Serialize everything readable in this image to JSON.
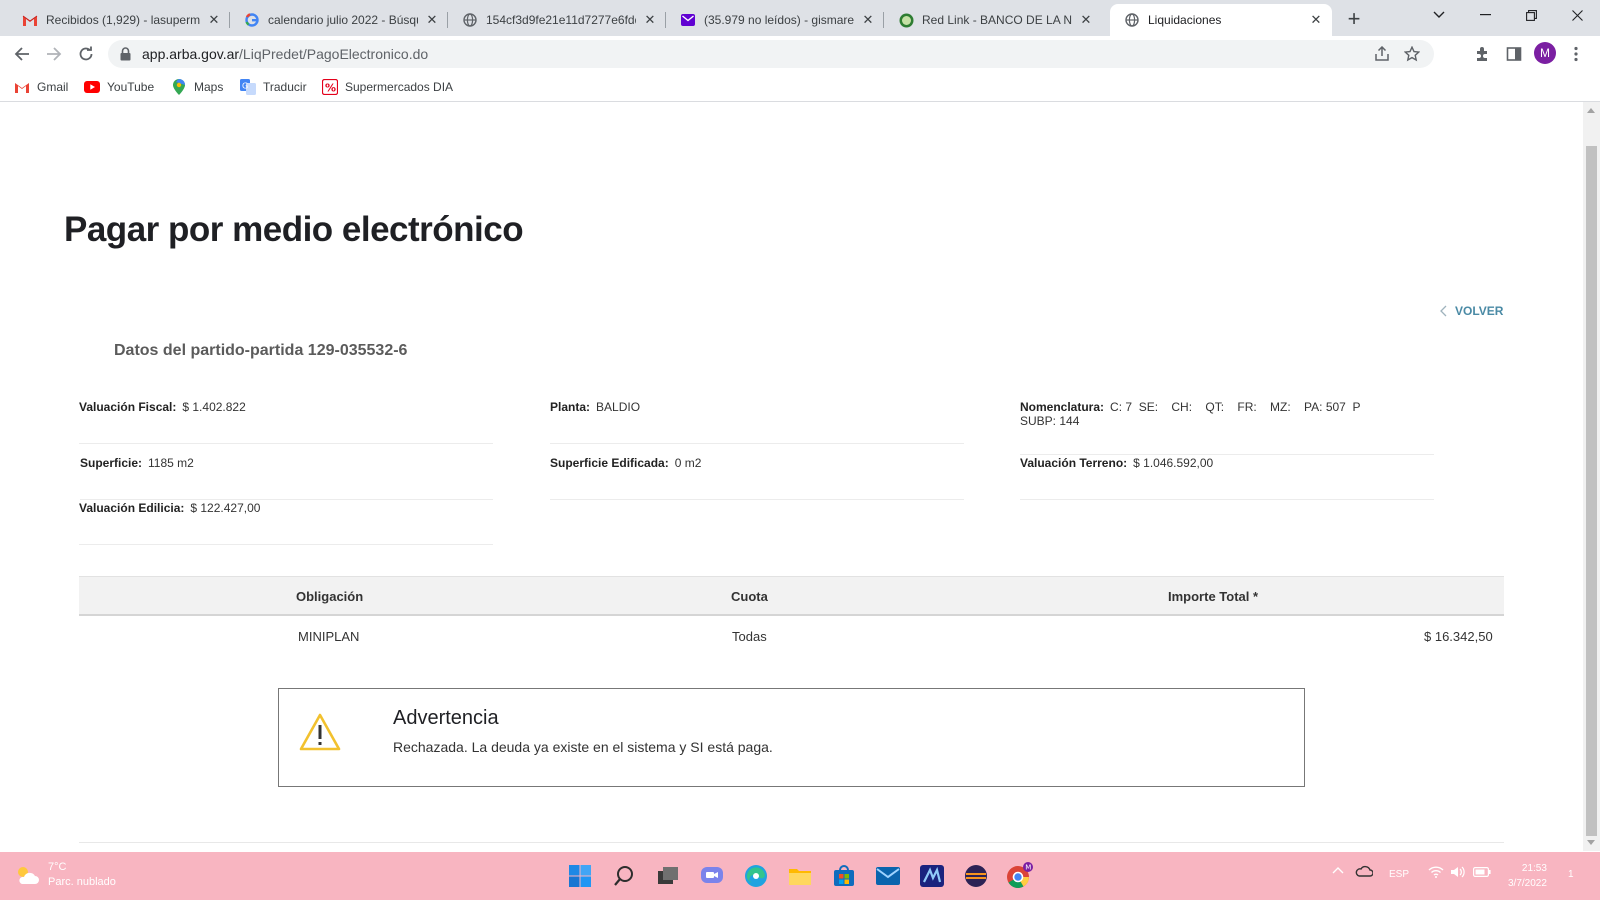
{
  "browser": {
    "tabs": [
      {
        "title": "Recibidos (1,929) - lasuperma",
        "icon": "gmail-icon"
      },
      {
        "title": "calendario julio 2022 - Búsque",
        "icon": "google-icon"
      },
      {
        "title": "154cf3d9fe21e11d7277e6fdd",
        "icon": "globe-icon"
      },
      {
        "title": "(35.979 no leídos) - gismares",
        "icon": "yahoo-mail-icon"
      },
      {
        "title": "Red Link - BANCO DE LA NAC",
        "icon": "red-link-icon"
      },
      {
        "title": "Liquidaciones",
        "icon": "globe-icon"
      }
    ],
    "active_tab": 5,
    "url_host": "app.arba.gov.ar",
    "url_path": "/LiqPredet/PagoElectronico.do",
    "profile_initial": "M",
    "bookmarks": [
      {
        "label": "Gmail",
        "icon": "gmail-icon"
      },
      {
        "label": "YouTube",
        "icon": "youtube-icon"
      },
      {
        "label": "Maps",
        "icon": "maps-icon"
      },
      {
        "label": "Traducir",
        "icon": "translate-icon"
      },
      {
        "label": "Supermercados DIA",
        "icon": "dia-icon"
      }
    ]
  },
  "page": {
    "title": "Pagar por medio electrónico",
    "back_label": "VOLVER",
    "section_title": "Datos del partido-partida 129-035532-6",
    "fields": {
      "valuacion_fiscal": {
        "label": "Valuación Fiscal:",
        "value": "$ 1.402.822"
      },
      "planta": {
        "label": "Planta:",
        "value": "BALDIO"
      },
      "nomenclatura": {
        "label": "Nomenclatura:",
        "value": "C: 7  SE:    CH:    QT:    FR:    MZ:    PA: 507  P",
        "value2": "SUBP: 144"
      },
      "superficie": {
        "label": "Superficie:",
        "value": "1185 m2"
      },
      "superficie_edificada": {
        "label": "Superficie Edificada:",
        "value": "0 m2"
      },
      "valuacion_terreno": {
        "label": "Valuación Terreno:",
        "value": "$ 1.046.592,00"
      },
      "valuacion_edilicia": {
        "label": "Valuación Edilicia:",
        "value": "$ 122.427,00"
      }
    },
    "table": {
      "headers": [
        "Obligación",
        "Cuota",
        "Importe Total *"
      ],
      "rows": [
        [
          "MINIPLAN",
          "Todas",
          "$ 16.342,50"
        ]
      ]
    },
    "warning": {
      "title": "Advertencia",
      "message": "Rechazada. La deuda ya existe en el sistema y SI está paga."
    }
  },
  "taskbar": {
    "weather_temp": "7°C",
    "weather_desc": "Parc. nublado",
    "language": "ESP",
    "time": "21:53",
    "date": "3/7/2022",
    "notification_count": "1",
    "accent": "#f8b5c1"
  }
}
